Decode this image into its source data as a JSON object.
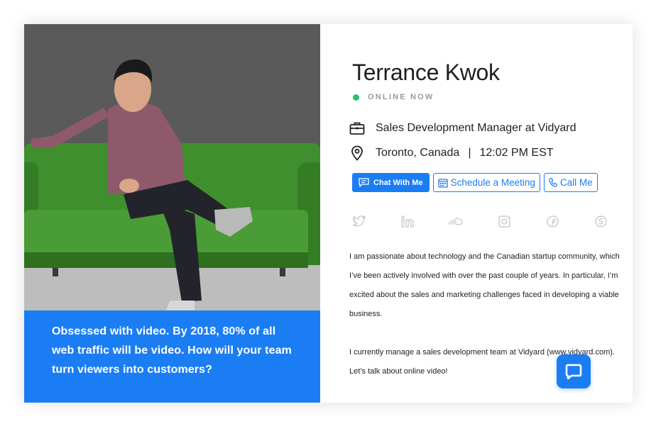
{
  "profile": {
    "name": "Terrance Kwok",
    "status": "ONLINE NOW",
    "title": "Sales Development Manager at Vidyard",
    "location": "Toronto, Canada",
    "separator": "|",
    "time": "12:02 PM EST"
  },
  "quote": "Obsessed with video. By 2018, 80% of all web traffic will be video. How will your team turn viewers into customers?",
  "actions": {
    "chat_label": "Chat With Me",
    "schedule_label": "Schedule a Meeting",
    "call_label": "Call Me"
  },
  "social": [
    "twitter-icon",
    "linkedin-icon",
    "soundcloud-icon",
    "instagram-icon",
    "pinterest-icon",
    "skype-icon"
  ],
  "bio": {
    "p1": "I am passionate about technology and the Canadian startup community, which I’ve been actively involved with over the past couple of years. In particular, I’m excited about the sales and marketing challenges faced in developing a viable business.",
    "p2": "I currently manage a sales development team at Vidyard (www.vidyard.com). Let’s talk about online video!"
  },
  "colors": {
    "accent": "#1b7df3",
    "online": "#27c26b",
    "social_icon": "#c4c4c4",
    "sofa": "#3f8f2e"
  }
}
